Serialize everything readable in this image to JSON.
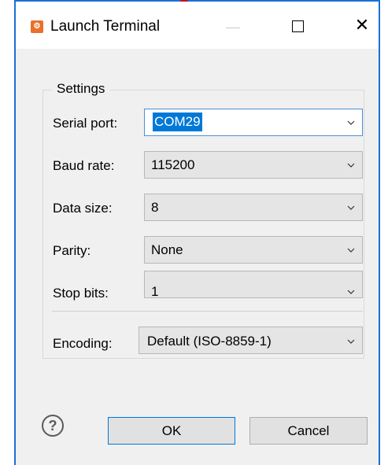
{
  "window": {
    "title": "Launch Terminal",
    "app_icon": "app-logo-icon",
    "controls": {
      "minimize": "minimize-icon",
      "maximize": "maximize-icon",
      "close": "close-icon",
      "close_glyph": "✕"
    }
  },
  "settings": {
    "legend": "Settings",
    "fields": [
      {
        "label": "Serial port:",
        "value": "COM29",
        "editable": true
      },
      {
        "label": "Baud rate:",
        "value": "115200"
      },
      {
        "label": "Data size:",
        "value": "8"
      },
      {
        "label": "Parity:",
        "value": "None"
      },
      {
        "label": "Stop bits:",
        "value": "1"
      }
    ],
    "encoding": {
      "label": "Encoding:",
      "value": "Default (ISO-8859-1)"
    }
  },
  "footer": {
    "help_glyph": "?",
    "ok_label": "OK",
    "cancel_label": "Cancel"
  },
  "colors": {
    "accent": "#0078d7",
    "window_border": "#1b6fd8",
    "app_icon": "#e8702a"
  }
}
